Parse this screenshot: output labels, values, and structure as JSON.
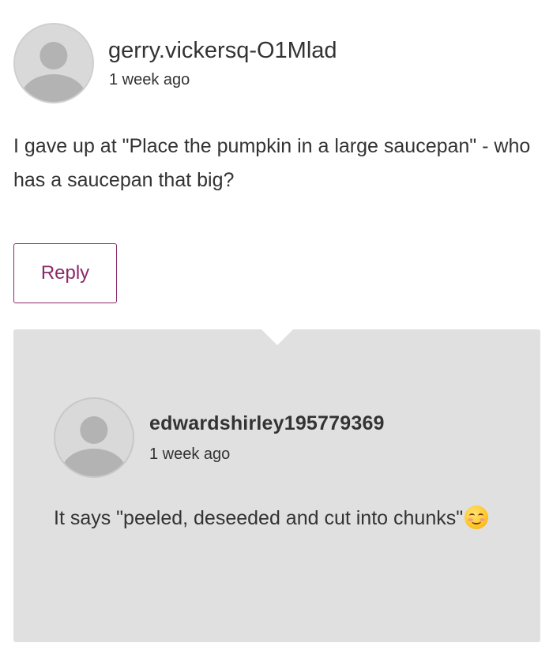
{
  "comment": {
    "username": "gerry.vickersq-O1Mlad",
    "timestamp": "1 week ago",
    "text": "I gave up at \"Place the pumpkin in a large saucepan\" - who has a saucepan that big?",
    "reply_label": "Reply"
  },
  "reply": {
    "username": "edwardshirley195779369",
    "timestamp": "1 week ago",
    "text": "It says \"peeled, deseeded and cut into chunks\"",
    "emoji": "smiling-face-emoji"
  },
  "colors": {
    "accent": "#8b2a6a",
    "reply_background": "#e0e0e0",
    "avatar_placeholder": "#b3b3b3",
    "text": "#333333"
  }
}
